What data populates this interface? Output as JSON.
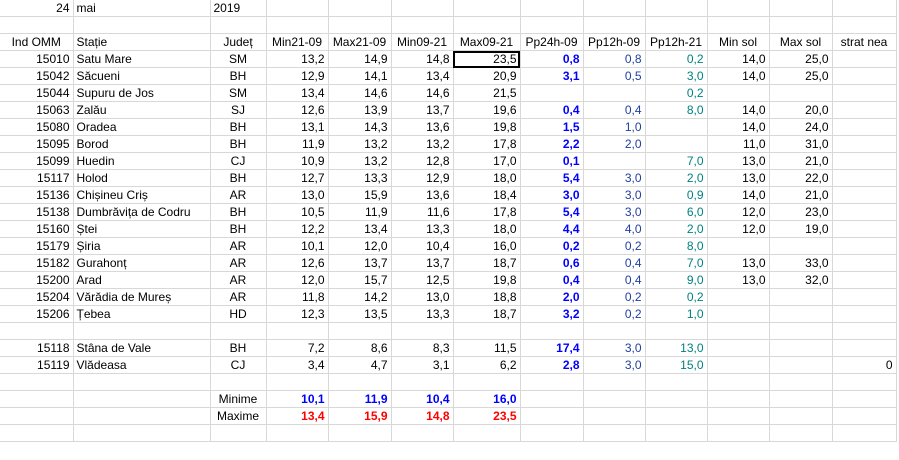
{
  "date": {
    "day": "24",
    "month": "mai",
    "year": "2019"
  },
  "headers": [
    "Ind OMM",
    "Stație",
    "Județ",
    "Min21-09",
    "Max21-09",
    "Min09-21",
    "Max09-21",
    "Pp24h-09",
    "Pp12h-09",
    "Pp12h-21",
    "Min sol",
    "Max sol",
    "strat nea"
  ],
  "rows": [
    [
      "15010",
      "Satu Mare",
      "SM",
      "13,2",
      "14,9",
      "14,8",
      "23,5",
      "0,8",
      "0,8",
      "0,2",
      "14,0",
      "25,0",
      ""
    ],
    [
      "15042",
      "Săcueni",
      "BH",
      "12,9",
      "14,1",
      "13,4",
      "20,9",
      "3,1",
      "0,5",
      "3,0",
      "14,0",
      "25,0",
      ""
    ],
    [
      "15044",
      "Supuru de Jos",
      "SM",
      "13,4",
      "14,6",
      "14,6",
      "21,5",
      "",
      "",
      "0,2",
      "",
      "",
      ""
    ],
    [
      "15063",
      "Zalău",
      "SJ",
      "12,6",
      "13,9",
      "13,7",
      "19,6",
      "0,4",
      "0,4",
      "8,0",
      "14,0",
      "20,0",
      ""
    ],
    [
      "15080",
      "Oradea",
      "BH",
      "13,1",
      "14,3",
      "13,6",
      "19,8",
      "1,5",
      "1,0",
      "",
      "14,0",
      "24,0",
      ""
    ],
    [
      "15095",
      "Borod",
      "BH",
      "11,9",
      "13,2",
      "13,2",
      "17,8",
      "2,2",
      "2,0",
      "",
      "11,0",
      "31,0",
      ""
    ],
    [
      "15099",
      "Huedin",
      "CJ",
      "10,9",
      "13,2",
      "12,8",
      "17,0",
      "0,1",
      "",
      "7,0",
      "13,0",
      "21,0",
      ""
    ],
    [
      "15117",
      "Holod",
      "BH",
      "12,7",
      "13,3",
      "12,9",
      "18,0",
      "5,4",
      "3,0",
      "2,0",
      "13,0",
      "22,0",
      ""
    ],
    [
      "15136",
      "Chișineu    Criș",
      "AR",
      "13,0",
      "15,9",
      "13,6",
      "18,4",
      "3,0",
      "3,0",
      "0,9",
      "14,0",
      "21,0",
      ""
    ],
    [
      "15138",
      "Dumbrăvița de Codru",
      "BH",
      "10,5",
      "11,9",
      "11,6",
      "17,8",
      "5,4",
      "3,0",
      "6,0",
      "12,0",
      "23,0",
      ""
    ],
    [
      "15160",
      "Ștei",
      "BH",
      "12,2",
      "13,4",
      "13,3",
      "18,0",
      "4,4",
      "4,0",
      "2,0",
      "12,0",
      "19,0",
      ""
    ],
    [
      "15179",
      "Șiria",
      "AR",
      "10,1",
      "12,0",
      "10,4",
      "16,0",
      "0,2",
      "0,2",
      "8,0",
      "",
      "",
      ""
    ],
    [
      "15182",
      "Gurahonț",
      "AR",
      "12,6",
      "13,7",
      "13,7",
      "18,7",
      "0,6",
      "0,4",
      "7,0",
      "13,0",
      "33,0",
      ""
    ],
    [
      "15200",
      "Arad",
      "AR",
      "12,0",
      "15,7",
      "12,5",
      "19,8",
      "0,4",
      "0,4",
      "9,0",
      "13,0",
      "32,0",
      ""
    ],
    [
      "15204",
      "Vărădia de Mureș",
      "AR",
      "11,8",
      "14,2",
      "13,0",
      "18,8",
      "2,0",
      "0,2",
      "0,2",
      "",
      "",
      ""
    ],
    [
      "15206",
      "Țebea",
      "HD",
      "12,3",
      "13,5",
      "13,3",
      "18,7",
      "3,2",
      "0,2",
      "1,0",
      "",
      "",
      ""
    ]
  ],
  "mountain_rows": [
    [
      "15118",
      "Stâna de Vale",
      "BH",
      "7,2",
      "8,6",
      "8,3",
      "11,5",
      "17,4",
      "3,0",
      "13,0",
      "",
      "",
      ""
    ],
    [
      "15119",
      "Vlădeasa",
      "CJ",
      "3,4",
      "4,7",
      "3,1",
      "6,2",
      "2,8",
      "3,0",
      "15,0",
      "",
      "",
      "0"
    ]
  ],
  "summary": {
    "min_label": "Minime",
    "max_label": "Maxime",
    "minimums": [
      "10,1",
      "11,9",
      "10,4",
      "16,0"
    ],
    "maximums": [
      "13,4",
      "15,9",
      "14,8",
      "23,5"
    ]
  },
  "colors": {
    "pp24": "#0000ff",
    "pp12_09": "#1f3f9f",
    "pp12_21": "#008080",
    "max": "#ff0000",
    "min": "#0000ff"
  }
}
